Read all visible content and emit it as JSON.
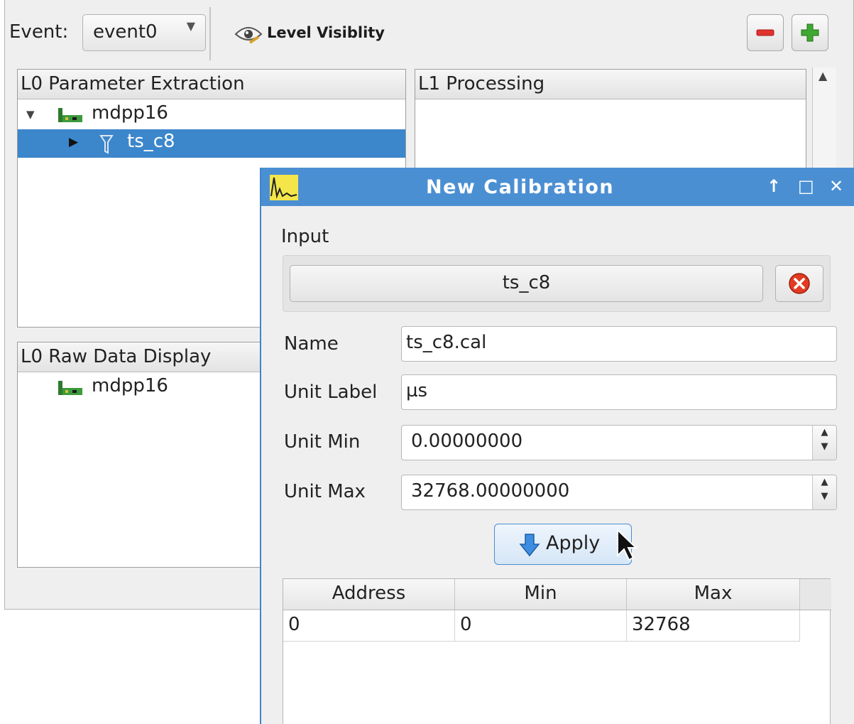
{
  "toolbar": {
    "event_label": "Event:",
    "event_value": "event0",
    "level_visibility_label": "Level Visiblity",
    "remove_icon": "minus-icon",
    "add_icon": "plus-icon"
  },
  "panels": {
    "l0_parameter_extraction": {
      "title": "L0 Parameter Extraction",
      "tree": [
        {
          "label": "mdpp16",
          "icon": "module-icon",
          "expanded": true
        },
        {
          "label": "ts_c8",
          "icon": "filter-icon",
          "selected": true
        }
      ]
    },
    "l1_processing": {
      "title": "L1 Processing"
    },
    "l0_raw_data_display": {
      "title": "L0 Raw Data Display",
      "tree": [
        {
          "label": "mdpp16",
          "icon": "module-icon"
        }
      ]
    }
  },
  "dialog": {
    "title": "New  Calibration",
    "input_section_label": "Input",
    "input_value": "ts_c8",
    "fields": {
      "name_label": "Name",
      "name_value": "ts_c8.cal",
      "unit_label_label": "Unit Label",
      "unit_label_value": "µs",
      "unit_min_label": "Unit Min",
      "unit_min_value": "0.00000000",
      "unit_max_label": "Unit Max",
      "unit_max_value": "32768.00000000"
    },
    "apply_label": "Apply",
    "table": {
      "columns": [
        "Address",
        "Min",
        "Max"
      ],
      "rows": [
        [
          "0",
          "0",
          "32768"
        ]
      ]
    }
  },
  "colors": {
    "titlebar": "#4b8fd3",
    "selection": "#3c86cb",
    "remove": "#e0322f",
    "add": "#3fa832"
  }
}
